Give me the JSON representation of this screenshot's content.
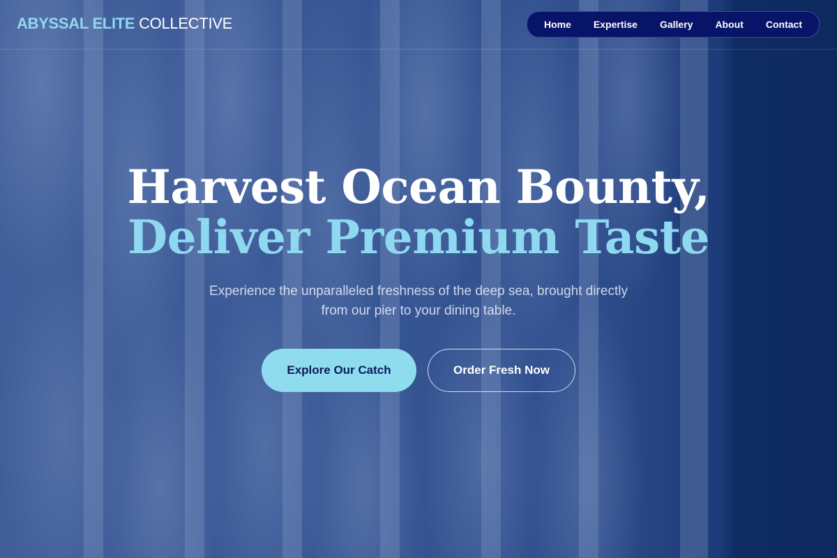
{
  "brand": {
    "accent_text": "ABYSSAL ELITE",
    "plain_text": "COLLECTIVE"
  },
  "nav": {
    "items": [
      "Home",
      "Expertise",
      "Gallery",
      "About",
      "Contact"
    ]
  },
  "hero": {
    "title_line1": "Harvest Ocean Bounty,",
    "title_line2": "Deliver Premium Taste",
    "subtitle": "Experience the unparalleled freshness of the deep sea, brought directly from our pier to your dining table.",
    "primary_cta": "Explore Our Catch",
    "secondary_cta": "Order Fresh Now"
  },
  "colors": {
    "accent": "#8fd9f0",
    "nav_bg": "#081468",
    "page_bg": "#0a2453"
  }
}
